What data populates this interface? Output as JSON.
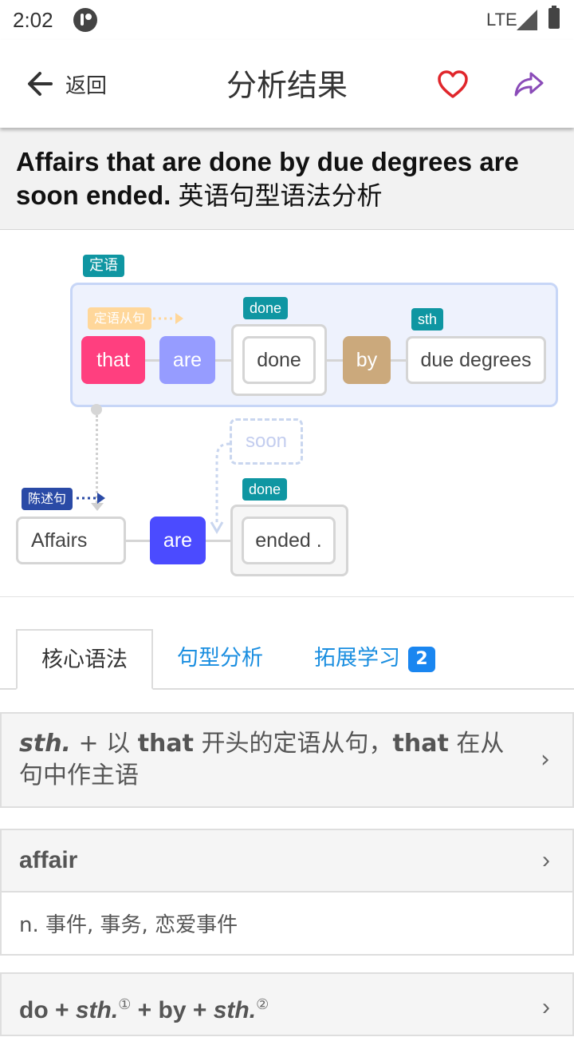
{
  "status_bar": {
    "time": "2:02",
    "network": "LTE"
  },
  "app_bar": {
    "back_label": "返回",
    "title": "分析结果"
  },
  "sentence": {
    "text": "Affairs that are done by due degrees are soon ended.",
    "suffix": "英语句型语法分析"
  },
  "diagram": {
    "clause_tag": "定语",
    "clause_type_tag": "定语从句",
    "main_type_tag": "陈述句",
    "done_tag_1": "done",
    "sth_tag": "sth",
    "done_tag_2": "done",
    "words": {
      "that": "that",
      "are1": "are",
      "done": "done",
      "by": "by",
      "due_degrees": "due degrees",
      "affairs": "Affairs",
      "are2": "are",
      "soon": "soon",
      "ended": "ended ."
    },
    "colors": {
      "that": "#ff3f7f",
      "are1": "#969cff",
      "by": "#cba97c",
      "are2": "#4b4bff",
      "tag_teal": "#0f96a2"
    }
  },
  "tabs": [
    {
      "label": "核心语法",
      "active": true
    },
    {
      "label": "句型分析",
      "active": false
    },
    {
      "label": "拓展学习",
      "active": false,
      "badge": "2"
    }
  ],
  "cards": {
    "c1": {
      "p1": "sth.",
      "p2": " + 以 ",
      "p3": "that",
      "p4": " 开头的定语从句，",
      "p5": "that",
      "p6": " 在从句中作主语"
    },
    "c2": {
      "title": "affair",
      "definition": "n. 事件, 事务, 恋爱事件"
    },
    "c3": {
      "p1": "do + ",
      "p2": "sth.",
      "s1": "①",
      "p3": " + by + ",
      "p4": "sth.",
      "s2": "②"
    }
  }
}
